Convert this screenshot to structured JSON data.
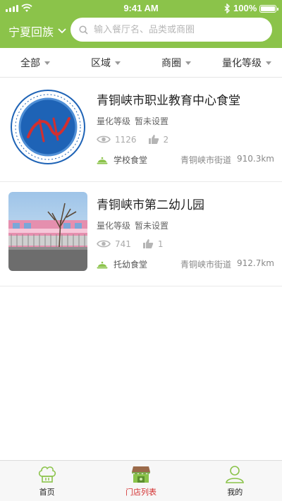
{
  "status": {
    "time": "9:41 AM",
    "battery": "100%"
  },
  "header": {
    "region": "宁夏回族",
    "search_placeholder": "输入餐厅名、品类或商圈"
  },
  "filters": [
    "全部",
    "区域",
    "商圈",
    "量化等级"
  ],
  "cards": [
    {
      "title": "青铜峡市职业教育中心食堂",
      "level_label": "量化等级",
      "level_value": "暂未设置",
      "views": "1126",
      "likes": "2",
      "type": "学校食堂",
      "street": "青铜峡市街道",
      "distance": "910.3km"
    },
    {
      "title": "青铜峡市第二幼儿园",
      "level_label": "量化等级",
      "level_value": "暂未设置",
      "views": "741",
      "likes": "1",
      "type": "托幼食堂",
      "street": "青铜峡市街道",
      "distance": "912.7km"
    }
  ],
  "tabs": [
    {
      "label": "首页",
      "icon": "chef-hat-icon"
    },
    {
      "label": "门店列表",
      "icon": "store-icon"
    },
    {
      "label": "我的",
      "icon": "user-icon"
    }
  ],
  "colors": {
    "brand": "#8bc34a",
    "active_tab": "#d32f2f",
    "badge_blue": "#1e63b6"
  }
}
